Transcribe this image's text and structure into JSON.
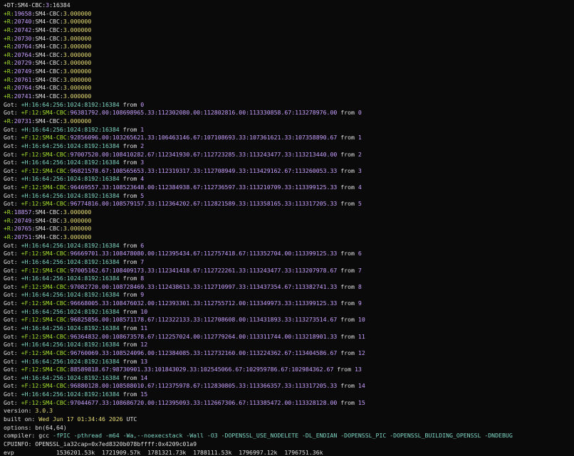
{
  "lines": [
    [
      [
        "w",
        "+DT:SM4-CBC:"
      ],
      [
        "p",
        "3"
      ],
      [
        "w",
        ":16384"
      ]
    ],
    [
      [
        "g",
        "+R:"
      ],
      [
        "p",
        "19658"
      ],
      [
        "w",
        ":SM4-CBC:"
      ],
      [
        "y",
        "3.000000"
      ]
    ],
    [
      [
        "g",
        "+R:"
      ],
      [
        "p",
        "20740"
      ],
      [
        "w",
        ":SM4-CBC:"
      ],
      [
        "y",
        "3.000000"
      ]
    ],
    [
      [
        "g",
        "+R:"
      ],
      [
        "p",
        "20742"
      ],
      [
        "w",
        ":SM4-CBC:"
      ],
      [
        "y",
        "3.000000"
      ]
    ],
    [
      [
        "g",
        "+R:"
      ],
      [
        "p",
        "20730"
      ],
      [
        "w",
        ":SM4-CBC:"
      ],
      [
        "y",
        "3.000000"
      ]
    ],
    [
      [
        "g",
        "+R:"
      ],
      [
        "p",
        "20764"
      ],
      [
        "w",
        ":SM4-CBC:"
      ],
      [
        "y",
        "3.000000"
      ]
    ],
    [
      [
        "g",
        "+R:"
      ],
      [
        "p",
        "20764"
      ],
      [
        "w",
        ":SM4-CBC:"
      ],
      [
        "y",
        "3.000000"
      ]
    ],
    [
      [
        "g",
        "+R:"
      ],
      [
        "p",
        "20729"
      ],
      [
        "w",
        ":SM4-CBC:"
      ],
      [
        "y",
        "3.000000"
      ]
    ],
    [
      [
        "g",
        "+R:"
      ],
      [
        "p",
        "20749"
      ],
      [
        "w",
        ":SM4-CBC:"
      ],
      [
        "y",
        "3.000000"
      ]
    ],
    [
      [
        "g",
        "+R:"
      ],
      [
        "p",
        "20761"
      ],
      [
        "w",
        ":SM4-CBC:"
      ],
      [
        "y",
        "3.000000"
      ]
    ],
    [
      [
        "g",
        "+R:"
      ],
      [
        "p",
        "20764"
      ],
      [
        "w",
        ":SM4-CBC:"
      ],
      [
        "y",
        "3.000000"
      ]
    ],
    [
      [
        "g",
        "+R:"
      ],
      [
        "p",
        "20741"
      ],
      [
        "w",
        ":SM4-CBC:"
      ],
      [
        "y",
        "3.000000"
      ]
    ],
    [
      [
        "w",
        "Got: "
      ],
      [
        "c",
        "+H:16:64:256:1024:8192:16384"
      ],
      [
        "w",
        " from "
      ],
      [
        "p",
        "0"
      ]
    ],
    [
      [
        "w",
        "Got: "
      ],
      [
        "g",
        "+F:12:SM4-CBC:"
      ],
      [
        "p",
        "96381792.00:108698965.33:112302080.00:112802816.00:113330858.67:113278976.00"
      ],
      [
        "w",
        " from "
      ],
      [
        "p",
        "0"
      ]
    ],
    [
      [
        "g",
        "+R:"
      ],
      [
        "p",
        "20731"
      ],
      [
        "w",
        ":SM4-CBC:"
      ],
      [
        "y",
        "3.000000"
      ]
    ],
    [
      [
        "w",
        "Got: "
      ],
      [
        "c",
        "+H:16:64:256:1024:8192:16384"
      ],
      [
        "w",
        " from "
      ],
      [
        "p",
        "1"
      ]
    ],
    [
      [
        "w",
        "Got: "
      ],
      [
        "g",
        "+F:12:SM4-CBC:"
      ],
      [
        "p",
        "92856096.00:103265621.33:106463146.67:107108693.33:107361621.33:107358890.67"
      ],
      [
        "w",
        " from "
      ],
      [
        "p",
        "1"
      ]
    ],
    [
      [
        "w",
        "Got: "
      ],
      [
        "c",
        "+H:16:64:256:1024:8192:16384"
      ],
      [
        "w",
        " from "
      ],
      [
        "p",
        "2"
      ]
    ],
    [
      [
        "w",
        "Got: "
      ],
      [
        "g",
        "+F:12:SM4-CBC:"
      ],
      [
        "p",
        "97007520.00:108410282.67:112341930.67:112723285.33:113243477.33:113213440.00"
      ],
      [
        "w",
        " from "
      ],
      [
        "p",
        "2"
      ]
    ],
    [
      [
        "w",
        "Got: "
      ],
      [
        "c",
        "+H:16:64:256:1024:8192:16384"
      ],
      [
        "w",
        " from "
      ],
      [
        "p",
        "3"
      ]
    ],
    [
      [
        "w",
        "Got: "
      ],
      [
        "g",
        "+F:12:SM4-CBC:"
      ],
      [
        "p",
        "96821578.67:108565653.33:112319317.33:112708949.33:113429162.67:113260053.33"
      ],
      [
        "w",
        " from "
      ],
      [
        "p",
        "3"
      ]
    ],
    [
      [
        "w",
        "Got: "
      ],
      [
        "c",
        "+H:16:64:256:1024:8192:16384"
      ],
      [
        "w",
        " from "
      ],
      [
        "p",
        "4"
      ]
    ],
    [
      [
        "w",
        "Got: "
      ],
      [
        "g",
        "+F:12:SM4-CBC:"
      ],
      [
        "p",
        "96469557.33:108523648.00:112384938.67:112736597.33:113210709.33:113399125.33"
      ],
      [
        "w",
        " from "
      ],
      [
        "p",
        "4"
      ]
    ],
    [
      [
        "w",
        "Got: "
      ],
      [
        "c",
        "+H:16:64:256:1024:8192:16384"
      ],
      [
        "w",
        " from "
      ],
      [
        "p",
        "5"
      ]
    ],
    [
      [
        "w",
        "Got: "
      ],
      [
        "g",
        "+F:12:SM4-CBC:"
      ],
      [
        "p",
        "96774816.00:108579157.33:112364202.67:112821589.33:113358165.33:113317205.33"
      ],
      [
        "w",
        " from "
      ],
      [
        "p",
        "5"
      ]
    ],
    [
      [
        "g",
        "+R:"
      ],
      [
        "p",
        "18857"
      ],
      [
        "w",
        ":SM4-CBC:"
      ],
      [
        "y",
        "3.000000"
      ]
    ],
    [
      [
        "g",
        "+R:"
      ],
      [
        "p",
        "20749"
      ],
      [
        "w",
        ":SM4-CBC:"
      ],
      [
        "y",
        "3.000000"
      ]
    ],
    [
      [
        "g",
        "+R:"
      ],
      [
        "p",
        "20765"
      ],
      [
        "w",
        ":SM4-CBC:"
      ],
      [
        "y",
        "3.000000"
      ]
    ],
    [
      [
        "g",
        "+R:"
      ],
      [
        "p",
        "20751"
      ],
      [
        "w",
        ":SM4-CBC:"
      ],
      [
        "y",
        "3.000000"
      ]
    ],
    [
      [
        "w",
        "Got: "
      ],
      [
        "c",
        "+H:16:64:256:1024:8192:16384"
      ],
      [
        "w",
        " from "
      ],
      [
        "p",
        "6"
      ]
    ],
    [
      [
        "w",
        "Got: "
      ],
      [
        "g",
        "+F:12:SM4-CBC:"
      ],
      [
        "p",
        "96669701.33:108478080.00:112395434.67:112757418.67:113352704.00:113399125.33"
      ],
      [
        "w",
        " from "
      ],
      [
        "p",
        "6"
      ]
    ],
    [
      [
        "w",
        "Got: "
      ],
      [
        "c",
        "+H:16:64:256:1024:8192:16384"
      ],
      [
        "w",
        " from "
      ],
      [
        "p",
        "7"
      ]
    ],
    [
      [
        "w",
        "Got: "
      ],
      [
        "g",
        "+F:12:SM4-CBC:"
      ],
      [
        "p",
        "97005162.67:108409173.33:112341418.67:112722261.33:113243477.33:113207978.67"
      ],
      [
        "w",
        " from "
      ],
      [
        "p",
        "7"
      ]
    ],
    [
      [
        "w",
        "Got: "
      ],
      [
        "c",
        "+H:16:64:256:1024:8192:16384"
      ],
      [
        "w",
        " from "
      ],
      [
        "p",
        "8"
      ]
    ],
    [
      [
        "w",
        "Got: "
      ],
      [
        "g",
        "+F:12:SM4-CBC:"
      ],
      [
        "p",
        "97082720.00:108728469.33:112438613.33:112710997.33:113437354.67:113382741.33"
      ],
      [
        "w",
        " from "
      ],
      [
        "p",
        "8"
      ]
    ],
    [
      [
        "w",
        "Got: "
      ],
      [
        "c",
        "+H:16:64:256:1024:8192:16384"
      ],
      [
        "w",
        " from "
      ],
      [
        "p",
        "9"
      ]
    ],
    [
      [
        "w",
        "Got: "
      ],
      [
        "g",
        "+F:12:SM4-CBC:"
      ],
      [
        "p",
        "96668005.33:108476032.00:112393301.33:112755712.00:113349973.33:113399125.33"
      ],
      [
        "w",
        " from "
      ],
      [
        "p",
        "9"
      ]
    ],
    [
      [
        "w",
        "Got: "
      ],
      [
        "c",
        "+H:16:64:256:1024:8192:16384"
      ],
      [
        "w",
        " from "
      ],
      [
        "p",
        "10"
      ]
    ],
    [
      [
        "w",
        "Got: "
      ],
      [
        "g",
        "+F:12:SM4-CBC:"
      ],
      [
        "p",
        "96825856.00:108571178.67:112322133.33:112708608.00:113431893.33:113273514.67"
      ],
      [
        "w",
        " from "
      ],
      [
        "p",
        "10"
      ]
    ],
    [
      [
        "w",
        "Got: "
      ],
      [
        "c",
        "+H:16:64:256:1024:8192:16384"
      ],
      [
        "w",
        " from "
      ],
      [
        "p",
        "11"
      ]
    ],
    [
      [
        "w",
        "Got: "
      ],
      [
        "g",
        "+F:12:SM4-CBC:"
      ],
      [
        "p",
        "96364832.00:108673578.67:112257024.00:112779264.00:113311744.00:113218901.33"
      ],
      [
        "w",
        " from "
      ],
      [
        "p",
        "11"
      ]
    ],
    [
      [
        "w",
        "Got: "
      ],
      [
        "c",
        "+H:16:64:256:1024:8192:16384"
      ],
      [
        "w",
        " from "
      ],
      [
        "p",
        "12"
      ]
    ],
    [
      [
        "w",
        "Got: "
      ],
      [
        "g",
        "+F:12:SM4-CBC:"
      ],
      [
        "p",
        "96760069.33:108524096.00:112384085.33:112732160.00:113224362.67:113404586.67"
      ],
      [
        "w",
        " from "
      ],
      [
        "p",
        "12"
      ]
    ],
    [
      [
        "w",
        "Got: "
      ],
      [
        "c",
        "+H:16:64:256:1024:8192:16384"
      ],
      [
        "w",
        " from "
      ],
      [
        "p",
        "13"
      ]
    ],
    [
      [
        "w",
        "Got: "
      ],
      [
        "g",
        "+F:12:SM4-CBC:"
      ],
      [
        "p",
        "88589818.67:98730901.33:101843029.33:102545066.67:102959786.67:102984362.67"
      ],
      [
        "w",
        " from "
      ],
      [
        "p",
        "13"
      ]
    ],
    [
      [
        "w",
        "Got: "
      ],
      [
        "c",
        "+H:16:64:256:1024:8192:16384"
      ],
      [
        "w",
        " from "
      ],
      [
        "p",
        "14"
      ]
    ],
    [
      [
        "w",
        "Got: "
      ],
      [
        "g",
        "+F:12:SM4-CBC:"
      ],
      [
        "p",
        "96880128.00:108588010.67:112375978.67:112830805.33:113366357.33:113317205.33"
      ],
      [
        "w",
        " from "
      ],
      [
        "p",
        "14"
      ]
    ],
    [
      [
        "w",
        "Got: "
      ],
      [
        "c",
        "+H:16:64:256:1024:8192:16384"
      ],
      [
        "w",
        " from "
      ],
      [
        "p",
        "15"
      ]
    ],
    [
      [
        "w",
        "Got: "
      ],
      [
        "g",
        "+F:12:SM4-CBC:"
      ],
      [
        "p",
        "97044677.33:108686720.00:112395093.33:112667306.67:113385472.00:113328128.00"
      ],
      [
        "w",
        " from "
      ],
      [
        "p",
        "15"
      ]
    ],
    [
      [
        "w",
        "version: "
      ],
      [
        "y",
        "3.0.3"
      ]
    ],
    [
      [
        "w",
        "built on: "
      ],
      [
        "y",
        "Wed Jun 17 01:34:46 2026"
      ],
      [
        "w",
        " UTC"
      ]
    ],
    [
      [
        "w",
        "options: bn(64,64)"
      ]
    ],
    [
      [
        "w",
        "compiler: gcc "
      ],
      [
        "c",
        "-fPIC -pthread -m64 -Wa,--noexecstack -Wall -O3 -DOPENSSL_USE_NODELETE -DL_ENDIAN -DOPENSSL_PIC -DOPENSSL_BUILDING_OPENSSL -DNDEBUG"
      ]
    ],
    [
      [
        "w",
        "CPUINFO: OPENSSL_ia32cap=0x7ed8320b078bffff:0x4209c01a9"
      ]
    ],
    [
      [
        "w",
        "evp            1536201.53k  1721909.57k  1781321.73k  1788111.53k  1796997.12k  1796751.36k"
      ]
    ]
  ]
}
